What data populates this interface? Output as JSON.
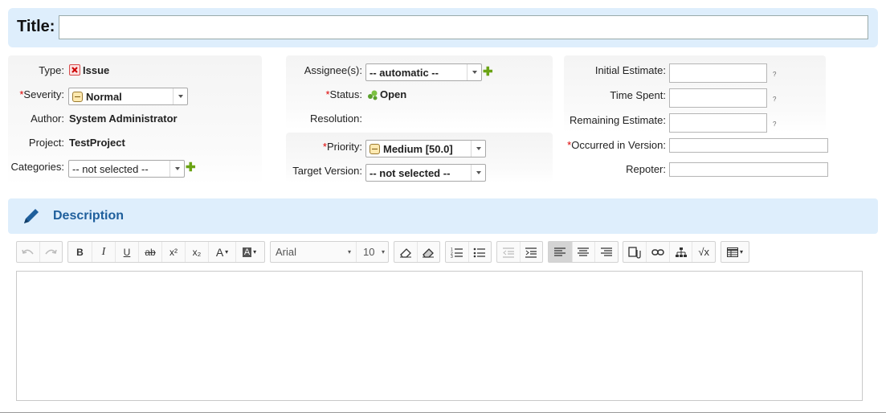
{
  "title": {
    "label": "Title:",
    "value": ""
  },
  "fields": {
    "type": {
      "label": "Type:",
      "value": "Issue"
    },
    "severity": {
      "label": "Severity:",
      "value": "Normal"
    },
    "author": {
      "label": "Author:",
      "value": "System Administrator"
    },
    "project": {
      "label": "Project:",
      "value": "TestProject"
    },
    "categories": {
      "label": "Categories:",
      "value": "-- not selected --"
    },
    "assignees": {
      "label": "Assignee(s):",
      "value": "-- automatic --"
    },
    "status": {
      "label": "Status:",
      "value": "Open"
    },
    "resolution": {
      "label": "Resolution:",
      "value": ""
    },
    "priority": {
      "label": "Priority:",
      "value": "Medium [50.0]"
    },
    "target_version": {
      "label": "Target Version:",
      "value": "-- not selected --"
    },
    "initial_estimate": {
      "label": "Initial Estimate:",
      "value": "",
      "help": "?"
    },
    "time_spent": {
      "label": "Time Spent:",
      "value": "",
      "help": "?"
    },
    "remaining_estimate": {
      "label": "Remaining Estimate:",
      "value": "",
      "help": "?"
    },
    "occurred_in_version": {
      "label": "Occurred in Version:",
      "value": ""
    },
    "reporter": {
      "label": "Repoter:",
      "value": ""
    }
  },
  "required_marker": "*",
  "add_symbol": "✚",
  "description": {
    "heading": "Description",
    "toolbar": {
      "font": "Arial",
      "size": "10",
      "font_color_label": "A",
      "bg_color_label": "A",
      "bold": "B",
      "italic": "I",
      "underline": "U",
      "strike": "ab",
      "superscript": "x²",
      "subscript": "x₂",
      "math": "√x"
    },
    "content": ""
  },
  "colors": {
    "accent_bg": "#deeefc",
    "heading": "#1f5f9c",
    "required": "#dd0000",
    "add_green": "#6aa314"
  }
}
